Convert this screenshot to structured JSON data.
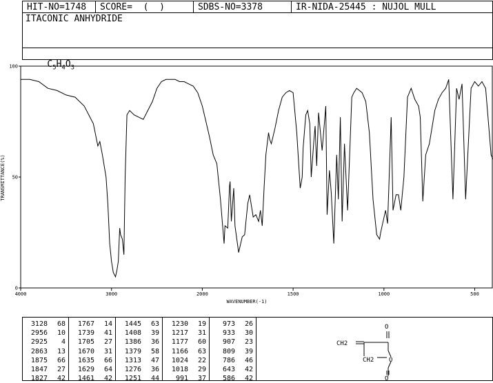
{
  "header": {
    "hit_no": "HIT-NO=1748",
    "score": "SCORE=  (  )",
    "sdbs_no": "SDBS-NO=3378",
    "ir_nida": "IR-NIDA-25445 : NUJOL MULL"
  },
  "compound_name": "ITACONIC ANHYDRIDE",
  "formula": {
    "c": "C",
    "c_n": "5",
    "h": "H",
    "h_n": "4",
    "o": "O",
    "o_n": "3"
  },
  "chart_data": {
    "type": "line",
    "xlabel": "WAVENUMBER(-1)",
    "ylabel": "TRANSMITTANCE(%)",
    "xlim": [
      4000,
      400
    ],
    "ylim": [
      0,
      100
    ],
    "x_ticks": [
      "4000",
      "3000",
      "2000",
      "1500",
      "1000",
      "500"
    ],
    "x_tick_values": [
      4000,
      3000,
      2000,
      1500,
      1000,
      500
    ],
    "y_ticks": [
      "100",
      "50",
      "0"
    ],
    "y_tick_values": [
      100,
      50,
      0
    ],
    "x": [
      4000,
      3900,
      3800,
      3700,
      3600,
      3500,
      3400,
      3300,
      3200,
      3150,
      3128,
      3100,
      3060,
      3040,
      3020,
      3000,
      2980,
      2956,
      2940,
      2925,
      2910,
      2900,
      2880,
      2863,
      2850,
      2830,
      2800,
      2750,
      2700,
      2650,
      2600,
      2550,
      2500,
      2450,
      2400,
      2350,
      2300,
      2250,
      2200,
      2150,
      2100,
      2050,
      2000,
      1980,
      1960,
      1940,
      1920,
      1900,
      1880,
      1875,
      1860,
      1850,
      1847,
      1840,
      1827,
      1820,
      1800,
      1780,
      1767,
      1750,
      1739,
      1720,
      1705,
      1690,
      1680,
      1670,
      1660,
      1650,
      1635,
      1629,
      1620,
      1600,
      1580,
      1560,
      1540,
      1520,
      1500,
      1480,
      1461,
      1450,
      1445,
      1430,
      1420,
      1408,
      1400,
      1386,
      1379,
      1370,
      1360,
      1340,
      1320,
      1313,
      1300,
      1290,
      1276,
      1260,
      1251,
      1240,
      1230,
      1217,
      1200,
      1177,
      1166,
      1150,
      1120,
      1100,
      1080,
      1060,
      1040,
      1024,
      1018,
      1010,
      991,
      980,
      973,
      960,
      950,
      933,
      920,
      907,
      890,
      870,
      850,
      830,
      809,
      800,
      786,
      770,
      750,
      720,
      700,
      680,
      660,
      643,
      620,
      600,
      586,
      570,
      550,
      520,
      500,
      480,
      460,
      440,
      420,
      410,
      400
    ],
    "values": [
      94,
      94,
      93,
      90,
      89,
      87,
      86,
      82,
      74,
      64,
      66,
      60,
      50,
      38,
      20,
      12,
      7,
      5,
      8,
      12,
      27,
      24,
      22,
      15,
      50,
      78,
      80,
      78,
      77,
      76,
      80,
      84,
      90,
      93,
      94,
      94,
      94,
      93,
      93,
      92,
      91,
      88,
      82,
      75,
      68,
      60,
      56,
      40,
      20,
      28,
      27,
      46,
      48,
      30,
      45,
      28,
      16,
      23,
      24,
      38,
      42,
      32,
      33,
      30,
      35,
      28,
      45,
      60,
      70,
      67,
      65,
      72,
      80,
      86,
      88,
      89,
      88,
      70,
      45,
      50,
      63,
      78,
      80,
      74,
      50,
      66,
      73,
      55,
      79,
      62,
      82,
      33,
      53,
      43,
      20,
      60,
      40,
      77,
      30,
      65,
      35,
      86,
      88,
      90,
      88,
      84,
      70,
      40,
      24,
      22,
      25,
      28,
      35,
      29,
      45,
      77,
      35,
      42,
      42,
      35,
      50,
      86,
      90,
      85,
      82,
      77,
      39,
      60,
      65,
      80,
      85,
      88,
      90,
      94,
      40,
      90,
      85,
      92,
      40,
      90,
      93,
      91,
      93,
      90,
      70,
      60,
      58,
      60
    ]
  },
  "peaks": {
    "col1": [
      [
        "3128",
        "68"
      ],
      [
        "2956",
        "10"
      ],
      [
        "2925",
        "4"
      ],
      [
        "2863",
        "13"
      ],
      [
        "1875",
        "66"
      ],
      [
        "1847",
        "27"
      ],
      [
        "1827",
        "42"
      ]
    ],
    "col2": [
      [
        "1767",
        "14"
      ],
      [
        "1739",
        "41"
      ],
      [
        "1705",
        "27"
      ],
      [
        "1670",
        "31"
      ],
      [
        "1635",
        "66"
      ],
      [
        "1629",
        "64"
      ],
      [
        "1461",
        "42"
      ]
    ],
    "col3": [
      [
        "1445",
        "63"
      ],
      [
        "1408",
        "39"
      ],
      [
        "1386",
        "36"
      ],
      [
        "1379",
        "58"
      ],
      [
        "1313",
        "47"
      ],
      [
        "1276",
        "36"
      ],
      [
        "1251",
        "44"
      ]
    ],
    "col4": [
      [
        "1230",
        "19"
      ],
      [
        "1217",
        "31"
      ],
      [
        "1177",
        "60"
      ],
      [
        "1166",
        "63"
      ],
      [
        "1024",
        "22"
      ],
      [
        "1018",
        "29"
      ],
      [
        "991",
        "37"
      ]
    ],
    "col5": [
      [
        "973",
        "26"
      ],
      [
        "933",
        "30"
      ],
      [
        "907",
        "23"
      ],
      [
        "809",
        "39"
      ],
      [
        "786",
        "46"
      ],
      [
        "643",
        "42"
      ],
      [
        "586",
        "42"
      ]
    ]
  },
  "structure_labels": {
    "o_top": "O",
    "ch2_left": "CH2",
    "ch2_bottom": "CH2",
    "o_ring": "O",
    "o_bottom": "O"
  }
}
